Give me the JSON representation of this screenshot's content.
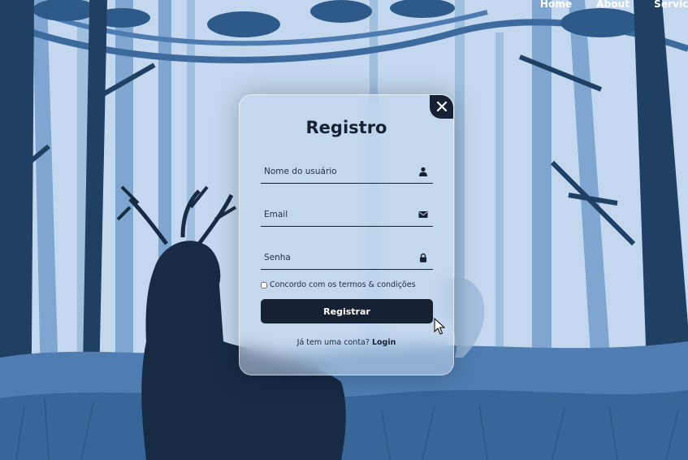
{
  "nav": {
    "items": [
      "Home",
      "About",
      "Services"
    ]
  },
  "modal": {
    "title": "Registro",
    "username_placeholder": "Nome do usuário",
    "email_placeholder": "Email",
    "password_placeholder": "Senha",
    "terms_label": "Concordo com os termos & condições",
    "submit_label": "Registrar",
    "have_account_text": "Já tem uma conta?",
    "login_link": "Login"
  },
  "icons": {
    "close": "close-icon",
    "username": "user-icon",
    "email": "envelope-icon",
    "password": "lock-icon"
  },
  "colors": {
    "accent": "#162233",
    "background_sky": "#bcd3ea"
  }
}
